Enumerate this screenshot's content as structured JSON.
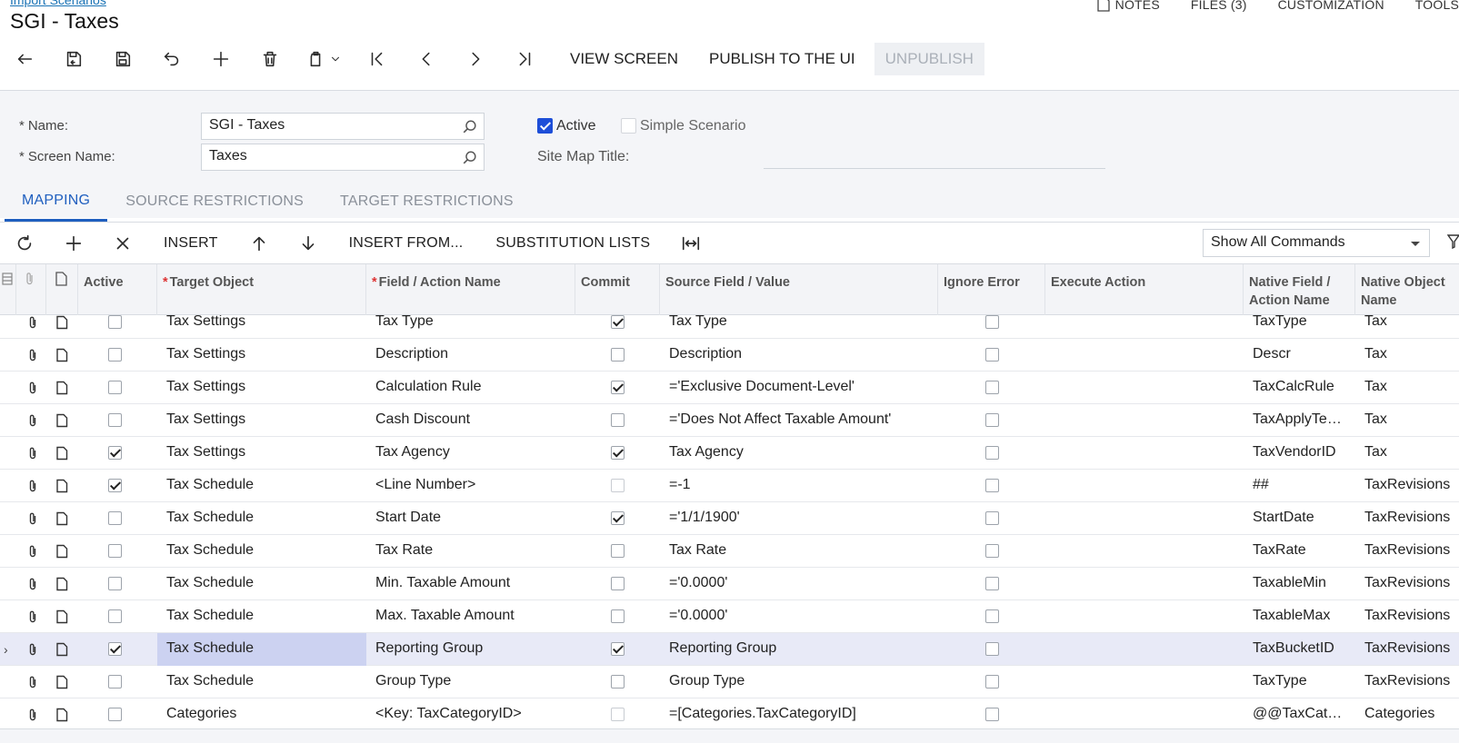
{
  "header": {
    "breadcrumb": "Import Scenarios",
    "title": "SGI - Taxes",
    "links": [
      {
        "label": "NOTES",
        "icon": "note-icon"
      },
      {
        "label": "FILES (3)"
      },
      {
        "label": "CUSTOMIZATION"
      },
      {
        "label": "TOOLS"
      }
    ]
  },
  "toolbar": {
    "icons": [
      "back-icon",
      "save-close-icon",
      "save-icon",
      "undo-icon",
      "add-icon",
      "delete-icon",
      "clipboard-icon",
      "first-icon",
      "prev-icon",
      "next-icon",
      "last-icon"
    ],
    "view_screen": "VIEW SCREEN",
    "publish": "PUBLISH TO THE UI",
    "unpublish": "UNPUBLISH"
  },
  "form": {
    "name_label": "Name:",
    "name_value": "SGI - Taxes",
    "screen_label": "Screen Name:",
    "screen_value": "Taxes",
    "active_label": "Active",
    "active_checked": true,
    "simple_label": "Simple Scenario",
    "simple_checked": false,
    "sitemap_label": "Site Map Title:",
    "required_mark": "*"
  },
  "tabs": [
    {
      "label": "MAPPING",
      "active": true
    },
    {
      "label": "SOURCE RESTRICTIONS",
      "active": false
    },
    {
      "label": "TARGET RESTRICTIONS",
      "active": false
    }
  ],
  "grid_toolbar": {
    "insert": "INSERT",
    "insert_from": "INSERT FROM...",
    "substitution": "SUBSTITUTION LISTS",
    "commands_select": "Show All Commands"
  },
  "columns": {
    "active": "Active",
    "target_object": "Target Object",
    "field_action": "Field / Action Name",
    "commit": "Commit",
    "source_field": "Source Field / Value",
    "ignore_error": "Ignore Error",
    "execute_action": "Execute Action",
    "native_field": "Native Field / Action Name",
    "native_object": "Native Object Name"
  },
  "rows": [
    {
      "active": false,
      "target": "Tax Settings",
      "field": "Tax Type",
      "commit": true,
      "commit_dim": false,
      "source": "Tax Type",
      "ignore": false,
      "native_field": "TaxType",
      "native_object": "Tax",
      "selected": false
    },
    {
      "active": false,
      "target": "Tax Settings",
      "field": "Description",
      "commit": false,
      "commit_dim": false,
      "source": "Description",
      "ignore": false,
      "native_field": "Descr",
      "native_object": "Tax",
      "selected": false
    },
    {
      "active": false,
      "target": "Tax Settings",
      "field": "Calculation Rule",
      "commit": true,
      "commit_dim": false,
      "source": "='Exclusive Document-Level'",
      "ignore": false,
      "native_field": "TaxCalcRule",
      "native_object": "Tax",
      "selected": false
    },
    {
      "active": false,
      "target": "Tax Settings",
      "field": "Cash Discount",
      "commit": false,
      "commit_dim": false,
      "source": "='Does Not Affect Taxable Amount'",
      "ignore": false,
      "native_field": "TaxApplyTe…",
      "native_object": "Tax",
      "selected": false
    },
    {
      "active": true,
      "target": "Tax Settings",
      "field": "Tax Agency",
      "commit": true,
      "commit_dim": false,
      "source": "Tax Agency",
      "ignore": false,
      "native_field": "TaxVendorID",
      "native_object": "Tax",
      "selected": false
    },
    {
      "active": true,
      "target": "Tax Schedule",
      "field": "<Line Number>",
      "commit": false,
      "commit_dim": true,
      "source": "=-1",
      "ignore": false,
      "native_field": "##",
      "native_object": "TaxRevisions",
      "selected": false
    },
    {
      "active": false,
      "target": "Tax Schedule",
      "field": "Start Date",
      "commit": true,
      "commit_dim": false,
      "source": "='1/1/1900'",
      "ignore": false,
      "native_field": "StartDate",
      "native_object": "TaxRevisions",
      "selected": false
    },
    {
      "active": false,
      "target": "Tax Schedule",
      "field": "Tax Rate",
      "commit": false,
      "commit_dim": false,
      "source": "Tax Rate",
      "ignore": false,
      "native_field": "TaxRate",
      "native_object": "TaxRevisions",
      "selected": false
    },
    {
      "active": false,
      "target": "Tax Schedule",
      "field": "Min. Taxable Amount",
      "commit": false,
      "commit_dim": false,
      "source": "='0.0000'",
      "ignore": false,
      "native_field": "TaxableMin",
      "native_object": "TaxRevisions",
      "selected": false
    },
    {
      "active": false,
      "target": "Tax Schedule",
      "field": "Max. Taxable Amount",
      "commit": false,
      "commit_dim": false,
      "source": "='0.0000'",
      "ignore": false,
      "native_field": "TaxableMax",
      "native_object": "TaxRevisions",
      "selected": false
    },
    {
      "active": true,
      "target": "Tax Schedule",
      "field": "Reporting Group",
      "commit": true,
      "commit_dim": false,
      "source": "Reporting Group",
      "ignore": false,
      "native_field": "TaxBucketID",
      "native_object": "TaxRevisions",
      "selected": true
    },
    {
      "active": false,
      "target": "Tax Schedule",
      "field": "Group Type",
      "commit": false,
      "commit_dim": false,
      "source": "Group Type",
      "ignore": false,
      "native_field": "TaxType",
      "native_object": "TaxRevisions",
      "selected": false
    },
    {
      "active": false,
      "target": "Categories",
      "field": "<Key: TaxCategoryID>",
      "commit": false,
      "commit_dim": true,
      "source": "=[Categories.TaxCategoryID]",
      "ignore": false,
      "native_field": "@@TaxCat…",
      "native_object": "Categories",
      "selected": false
    }
  ]
}
